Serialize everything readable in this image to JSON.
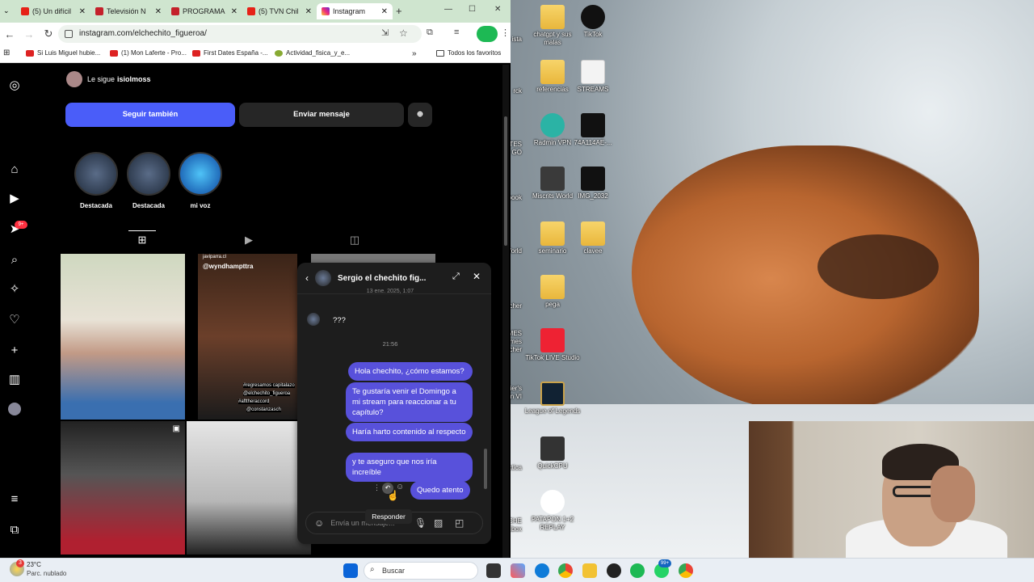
{
  "browser": {
    "tabs": [
      {
        "label": "(5) Un difícil",
        "fav_color": "#e62117"
      },
      {
        "label": "Televisión N",
        "fav_color": "#c4202a"
      },
      {
        "label": "PROGRAMA",
        "fav_color": "#c4202a"
      },
      {
        "label": "(5) TVN Chil",
        "fav_color": "#e62117"
      },
      {
        "label": "Instagram",
        "fav_color": "#d6249f"
      }
    ],
    "new_tab": "+",
    "window_controls": [
      "—",
      "☐",
      "✕"
    ],
    "url": "instagram.com/elchechito_figueroa/",
    "bookmarks": [
      "Si Luis Miguel hubie...",
      "(1) Mon Laferte - Pro...",
      "First Dates España -...",
      "Actividad_fisica_y_e...",
      "Todos los favoritos"
    ],
    "bookmarks_more": "»"
  },
  "instagram": {
    "followed_by_prefix": "Le sigue",
    "followed_by_user": "isiolmoss",
    "follow_back_button": "Seguir también",
    "message_button": "Enviar mensaje",
    "highlights": [
      "Destacada",
      "Destacada",
      "mi voz"
    ],
    "notification_badge": "9+",
    "post_tags": [
      "javiparra.cl",
      "@wyndhampttra",
      "#regresamos capitalazo",
      "@elchechito_figueroa",
      "#afttheraccord",
      "@constanzasch"
    ]
  },
  "chat": {
    "title": "Sergio el chechito fig...",
    "partial_timestamp": "13 ene. 2025, 1:07",
    "incoming_message": "???",
    "time_separator": "21:56",
    "messages": [
      "Hola chechito, ¿cómo estamos?",
      "Te gustaría venir el Domingo a mi stream para reaccionar a tu capítulo?",
      "Haría harto contenido al respecto",
      "y te aseguro que nos iría increíble",
      "Quedo atento"
    ],
    "input_placeholder": "Envía un mensaje...",
    "tooltip": "Responder",
    "accent": "#5851db"
  },
  "desktop": {
    "icons": [
      "chatgpt y sus malas",
      "TikTok",
      "referencias",
      "STREAMS",
      "Radmin VPN",
      "74A114AE-...",
      "Miscrits World",
      "IMG_2032",
      "seminario",
      "clavee",
      "pega",
      "TikTok LIVE Studio",
      "League of Legends",
      "QuickCPU",
      "PATAPON 1+2 REPLAY"
    ],
    "partial_icons": [
      "ista",
      "rck",
      "ORTES GO",
      "book",
      "World",
      "cher",
      "PIC MES ames cher",
      "VI feier's ation VI",
      "ctica",
      "ICHE ndbox"
    ]
  },
  "taskbar": {
    "weather_temp": "23°C",
    "weather_desc": "Parc. nublado",
    "weather_badge": "3",
    "search_placeholder": "Buscar",
    "notif_badge": "99+"
  }
}
